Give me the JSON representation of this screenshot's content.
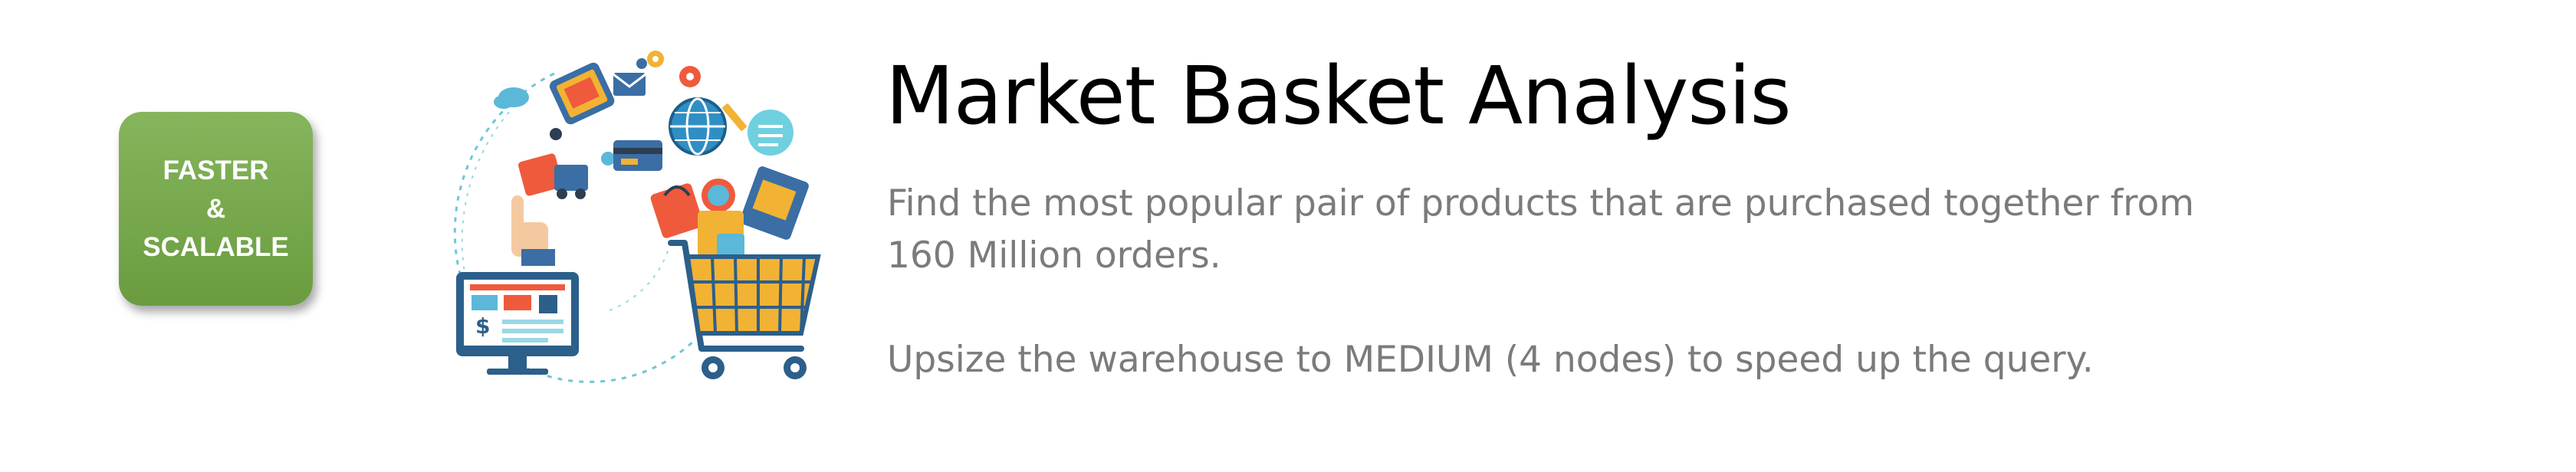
{
  "badge": {
    "line1": "FASTER",
    "line2": "&",
    "line3": "SCALABLE",
    "color": "#78a94b"
  },
  "illustration": {
    "icon": "shopping-ecommerce-icon",
    "price_symbol": "$"
  },
  "title": "Market Basket Analysis",
  "description": "Find the most popular pair of products that are purchased together from 160 Million orders.",
  "note": "Upsize the warehouse to MEDIUM (4 nodes) to speed up the query."
}
